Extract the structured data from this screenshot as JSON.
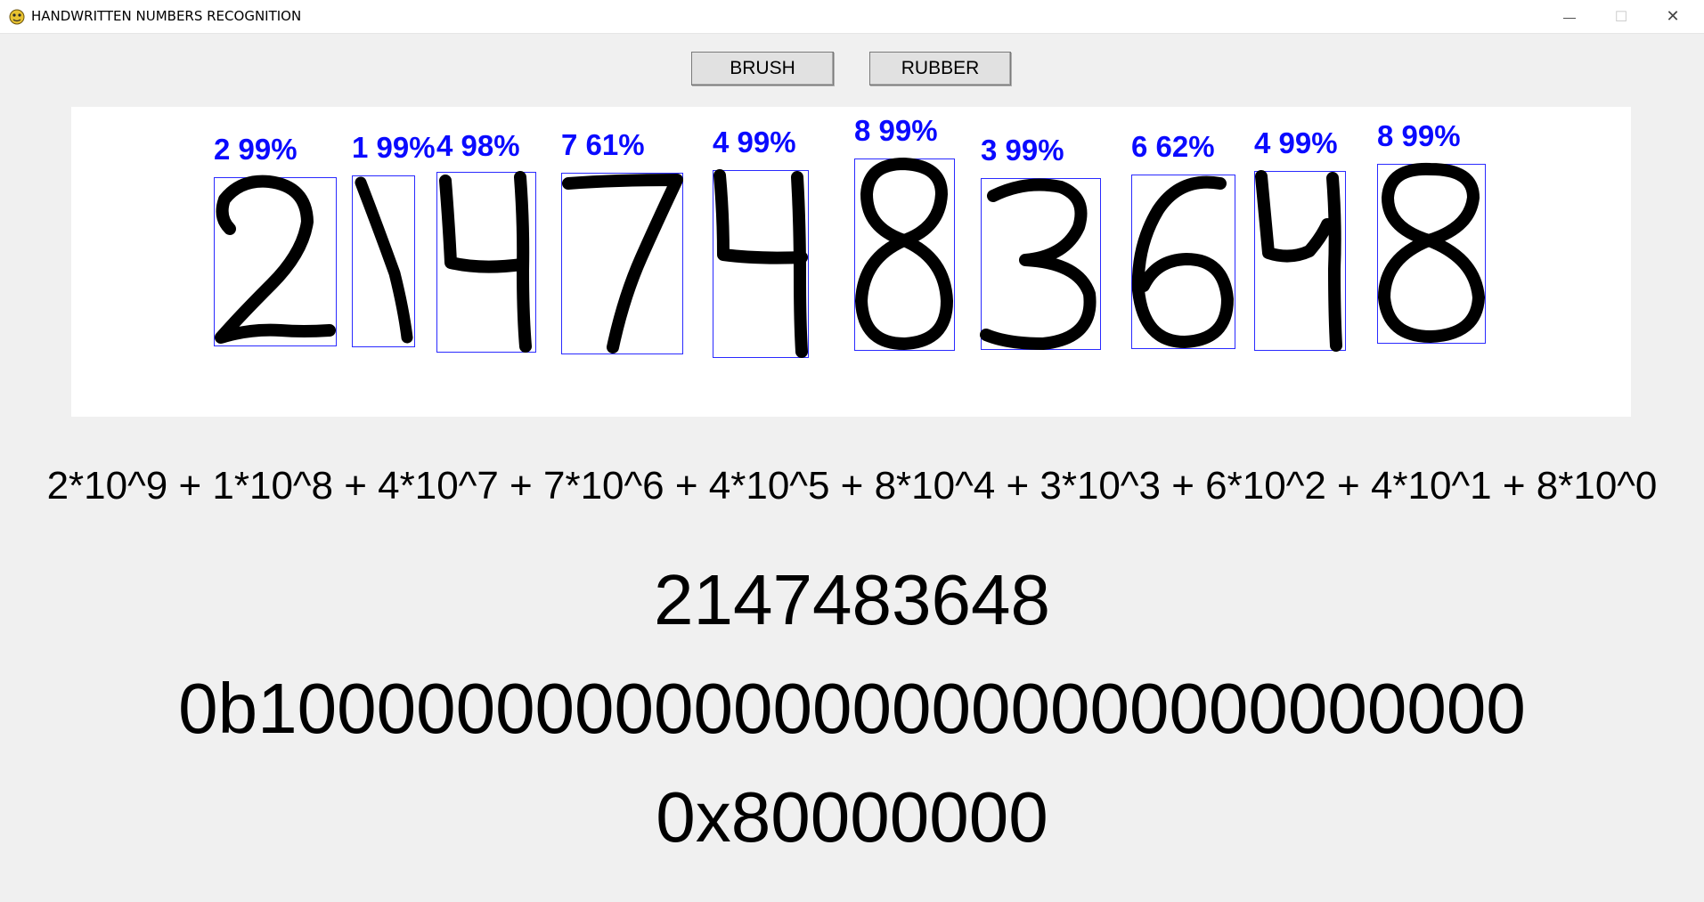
{
  "window": {
    "title": "HANDWRITTEN NUMBERS RECOGNITION",
    "minimize_glyph": "—",
    "maximize_glyph": "☐",
    "close_glyph": "✕"
  },
  "toolbar": {
    "brush_label": "BRUSH",
    "rubber_label": "RUBBER"
  },
  "colors": {
    "prediction_text": "#0a0aff",
    "bounding_box": "#2a2aff",
    "ink": "#000000",
    "canvas_bg": "#ffffff",
    "window_bg": "#f0f0f0"
  },
  "digits": [
    {
      "digit": "2",
      "label": "2 99%"
    },
    {
      "digit": "1",
      "label": "1 99%"
    },
    {
      "digit": "4",
      "label": "4 98%"
    },
    {
      "digit": "7",
      "label": "7 61%"
    },
    {
      "digit": "4",
      "label": "4 99%"
    },
    {
      "digit": "8",
      "label": "8 99%"
    },
    {
      "digit": "3",
      "label": "3 99%"
    },
    {
      "digit": "6",
      "label": "6 62%"
    },
    {
      "digit": "4",
      "label": "4 99%"
    },
    {
      "digit": "8",
      "label": "8 99%"
    }
  ],
  "results": {
    "expansion": "2*10^9 + 1*10^8 + 4*10^7 + 7*10^6 + 4*10^5 + 8*10^4 + 3*10^3 + 6*10^2 + 4*10^1 + 8*10^0",
    "decimal": "2147483648",
    "binary": "0b10000000000000000000000000000000",
    "hex": "0x80000000"
  }
}
